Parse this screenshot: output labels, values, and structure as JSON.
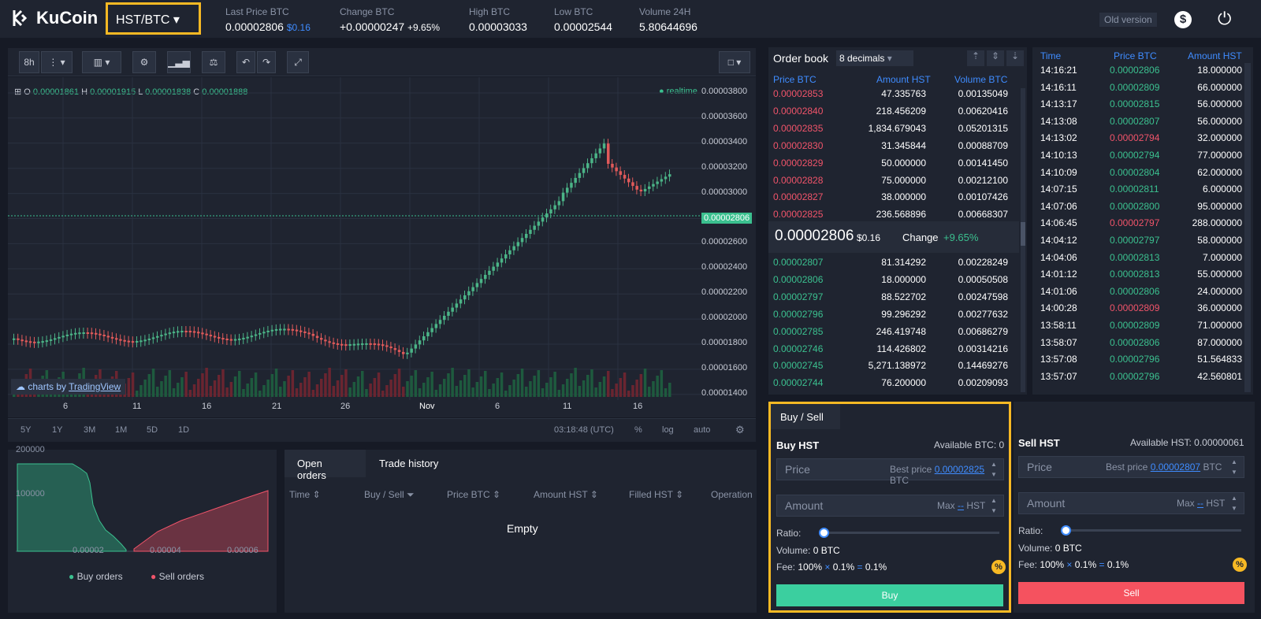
{
  "header": {
    "logo": "KuCoin",
    "pair": "HST/BTC",
    "old_version": "Old version",
    "stats": [
      {
        "label": "Last Price BTC",
        "value": "0.00002806",
        "extra": "$0.16"
      },
      {
        "label": "Change BTC",
        "value": "+0.00000247",
        "extra": "+9.65%"
      },
      {
        "label": "High BTC",
        "value": "0.00003033"
      },
      {
        "label": "Low BTC",
        "value": "0.00002544"
      },
      {
        "label": "Volume 24H",
        "value": "5.80644696"
      }
    ]
  },
  "chart": {
    "interval": "8h",
    "ohlc": {
      "o_label": "O",
      "o": "0.00001861",
      "h_label": "H",
      "h": "0.00001915",
      "l_label": "L",
      "l": "0.00001838",
      "c_label": "C",
      "c": "0.00001888"
    },
    "realtime": "realtime",
    "current_price": "0.00002806",
    "attribution_pre": "charts by",
    "attribution": "TradingView",
    "y_ticks": [
      "0.00003800",
      "0.00003600",
      "0.00003400",
      "0.00003200",
      "0.00003000",
      "0.00002806",
      "0.00002600",
      "0.00002400",
      "0.00002200",
      "0.00002000",
      "0.00001800",
      "0.00001600",
      "0.00001400"
    ],
    "x_ticks": [
      "6",
      "11",
      "16",
      "21",
      "26",
      "Nov",
      "6",
      "11",
      "16"
    ],
    "ranges": [
      "5Y",
      "1Y",
      "3M",
      "1M",
      "5D",
      "1D"
    ],
    "bottom_right": {
      "time": "03:18:48 (UTC)",
      "pct": "%",
      "log": "log",
      "auto": "auto"
    }
  },
  "orderbook": {
    "title": "Order book",
    "decimals": "8 decimals",
    "headers": [
      "Price BTC",
      "Amount HST",
      "Volume BTC"
    ],
    "asks": [
      [
        "0.00002853",
        "47.335763",
        "0.00135049"
      ],
      [
        "0.00002840",
        "218.456209",
        "0.00620416"
      ],
      [
        "0.00002835",
        "1,834.679043",
        "0.05201315"
      ],
      [
        "0.00002830",
        "31.345844",
        "0.00088709"
      ],
      [
        "0.00002829",
        "50.000000",
        "0.00141450"
      ],
      [
        "0.00002828",
        "75.000000",
        "0.00212100"
      ],
      [
        "0.00002827",
        "38.000000",
        "0.00107426"
      ],
      [
        "0.00002825",
        "236.568896",
        "0.00668307"
      ]
    ],
    "mid": {
      "price": "0.00002806",
      "usd": "$0.16",
      "change_label": "Change",
      "change": "+9.65%"
    },
    "bids": [
      [
        "0.00002807",
        "81.314292",
        "0.00228249"
      ],
      [
        "0.00002806",
        "18.000000",
        "0.00050508"
      ],
      [
        "0.00002797",
        "88.522702",
        "0.00247598"
      ],
      [
        "0.00002796",
        "99.296292",
        "0.00277632"
      ],
      [
        "0.00002785",
        "246.419748",
        "0.00686279"
      ],
      [
        "0.00002746",
        "114.426802",
        "0.00314216"
      ],
      [
        "0.00002745",
        "5,271.138972",
        "0.14469276"
      ],
      [
        "0.00002744",
        "76.200000",
        "0.00209093"
      ]
    ]
  },
  "trades": {
    "headers": [
      "Time",
      "Price BTC",
      "Amount HST"
    ],
    "rows": [
      [
        "14:16:21",
        "0.00002806",
        "18.000000",
        "g"
      ],
      [
        "14:16:11",
        "0.00002809",
        "66.000000",
        "g"
      ],
      [
        "14:13:17",
        "0.00002815",
        "56.000000",
        "g"
      ],
      [
        "14:13:08",
        "0.00002807",
        "56.000000",
        "g"
      ],
      [
        "14:13:02",
        "0.00002794",
        "32.000000",
        "r"
      ],
      [
        "14:10:13",
        "0.00002794",
        "77.000000",
        "g"
      ],
      [
        "14:10:09",
        "0.00002804",
        "62.000000",
        "g"
      ],
      [
        "14:07:15",
        "0.00002811",
        "6.000000",
        "g"
      ],
      [
        "14:07:06",
        "0.00002800",
        "95.000000",
        "g"
      ],
      [
        "14:06:45",
        "0.00002797",
        "288.000000",
        "r"
      ],
      [
        "14:04:12",
        "0.00002797",
        "58.000000",
        "g"
      ],
      [
        "14:04:06",
        "0.00002813",
        "7.000000",
        "g"
      ],
      [
        "14:01:12",
        "0.00002813",
        "55.000000",
        "g"
      ],
      [
        "14:01:06",
        "0.00002806",
        "24.000000",
        "g"
      ],
      [
        "14:00:28",
        "0.00002809",
        "36.000000",
        "r"
      ],
      [
        "13:58:11",
        "0.00002809",
        "71.000000",
        "g"
      ],
      [
        "13:58:07",
        "0.00002806",
        "87.000000",
        "g"
      ],
      [
        "13:57:08",
        "0.00002796",
        "51.564833",
        "g"
      ],
      [
        "13:57:07",
        "0.00002796",
        "42.560801",
        "g"
      ]
    ]
  },
  "buy": {
    "tab": "Buy / Sell",
    "title": "Buy HST",
    "available": "Available BTC: 0",
    "price_label": "Price",
    "best_price_label": "Best price",
    "best_price": "0.00002825",
    "unit": "BTC",
    "amount_label": "Amount",
    "max_label": "Max",
    "max_val": "--",
    "amount_unit": "HST",
    "ratio_label": "Ratio:",
    "volume_label": "Volume:",
    "volume": "0 BTC",
    "fee_label": "Fee:",
    "fee1": "100%",
    "x": "×",
    "fee2": "0.1%",
    "eq": "=",
    "fee3": "0.1%",
    "button": "Buy"
  },
  "sell": {
    "title": "Sell HST",
    "available": "Available HST: 0.00000061",
    "price_label": "Price",
    "best_price_label": "Best price",
    "best_price": "0.00002807",
    "unit": "BTC",
    "amount_label": "Amount",
    "max_label": "Max",
    "max_val": "--",
    "amount_unit": "HST",
    "ratio_label": "Ratio:",
    "volume_label": "Volume:",
    "volume": "0 BTC",
    "fee_label": "Fee:",
    "fee1": "100%",
    "x": "×",
    "fee2": "0.1%",
    "eq": "=",
    "fee3": "0.1%",
    "button": "Sell"
  },
  "depth": {
    "y_ticks": [
      "200000",
      "100000"
    ],
    "x_ticks": [
      "0.00002",
      "0.00004",
      "0.00006"
    ],
    "legend_buy": "Buy orders",
    "legend_sell": "Sell orders"
  },
  "orders": {
    "tabs": [
      "Open orders",
      "Trade history"
    ],
    "headers": [
      "Time",
      "Buy / Sell",
      "Price BTC",
      "Amount HST",
      "Filled HST",
      "Operation"
    ],
    "empty": "Empty"
  }
}
